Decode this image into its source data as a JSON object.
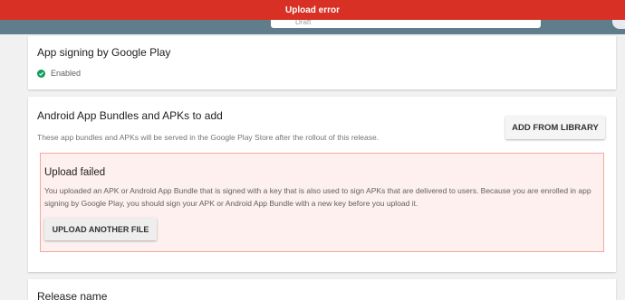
{
  "header": {
    "left_fragment": "··",
    "status_value": "Draft"
  },
  "banner": {
    "message": "Upload error"
  },
  "app_signing": {
    "title": "App signing by Google Play",
    "status": "Enabled"
  },
  "bundles": {
    "title": "Android App Bundles and APKs to add",
    "description": "These app bundles and APKs will be served in the Google Play Store after the rollout of this release.",
    "add_button": "ADD FROM LIBRARY",
    "error": {
      "title": "Upload failed",
      "message": "You uploaded an APK or Android App Bundle that is signed with a key that is also used to sign APKs that are delivered to users. Because you are enrolled in app signing by Google Play, you should sign your APK or Android App Bundle with a new key before you upload it.",
      "upload_button": "UPLOAD ANOTHER FILE"
    }
  },
  "release": {
    "title": "Release name"
  },
  "colors": {
    "banner": "#d93025",
    "topbar": "#607d8b",
    "success": "#0f9d58",
    "error_bg": "#fdf0ee",
    "error_border": "#f2a99e"
  },
  "icons": {
    "enabled": "check-circle-icon"
  }
}
